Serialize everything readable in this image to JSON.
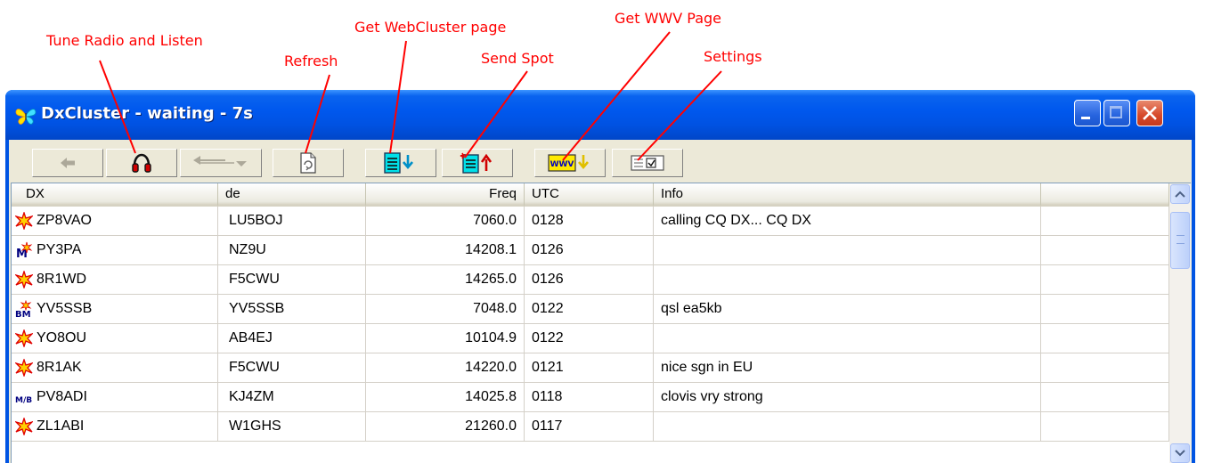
{
  "annotations": {
    "tune": "Tune Radio and Listen",
    "refresh": "Refresh",
    "webcluster": "Get WebCluster page",
    "send_spot": "Send Spot",
    "wwv": "Get WWV Page",
    "settings": "Settings"
  },
  "window": {
    "title": "DxCluster - waiting - 7s"
  },
  "toolbar": {
    "buttons": [
      "back-icon",
      "headphones-icon",
      "slider-icon",
      "refresh-icon",
      "get-webcluster-icon",
      "send-spot-icon",
      "get-wwv-icon",
      "settings-icon"
    ],
    "wwv_badge": "WWV"
  },
  "table": {
    "columns": [
      "DX",
      "de",
      "Freq",
      "UTC",
      "Info"
    ],
    "rows": [
      {
        "icon": "star-burst-icon",
        "dx": "ZP8VAO",
        "de": "LU5BOJ",
        "freq": "7060.0",
        "utc": "0128",
        "info": "calling CQ DX... CQ DX"
      },
      {
        "icon": "mode-m-icon",
        "dx": "PY3PA",
        "de": "NZ9U",
        "freq": "14208.1",
        "utc": "0126",
        "info": ""
      },
      {
        "icon": "star-burst-icon",
        "dx": "8R1WD",
        "de": "F5CWU",
        "freq": "14265.0",
        "utc": "0126",
        "info": ""
      },
      {
        "icon": "mode-bm-icon",
        "dx": "YV5SSB",
        "de": "YV5SSB",
        "freq": "7048.0",
        "utc": "0122",
        "info": "qsl ea5kb"
      },
      {
        "icon": "star-burst-icon",
        "dx": "YO8OU",
        "de": "AB4EJ",
        "freq": "10104.9",
        "utc": "0122",
        "info": ""
      },
      {
        "icon": "star-burst-icon",
        "dx": "8R1AK",
        "de": "F5CWU",
        "freq": "14220.0",
        "utc": "0121",
        "info": "nice sgn in EU"
      },
      {
        "icon": "mode-mb-icon",
        "dx": "PV8ADI",
        "de": "KJ4ZM",
        "freq": "14025.8",
        "utc": "0118",
        "info": "clovis  vry strong"
      },
      {
        "icon": "star-burst-icon",
        "dx": "ZL1ABI",
        "de": "W1GHS",
        "freq": "21260.0",
        "utc": "0117",
        "info": ""
      }
    ]
  },
  "colors": {
    "annotation": "#ff0000",
    "titlebar": "#0058ee",
    "face": "#ece9d8"
  }
}
